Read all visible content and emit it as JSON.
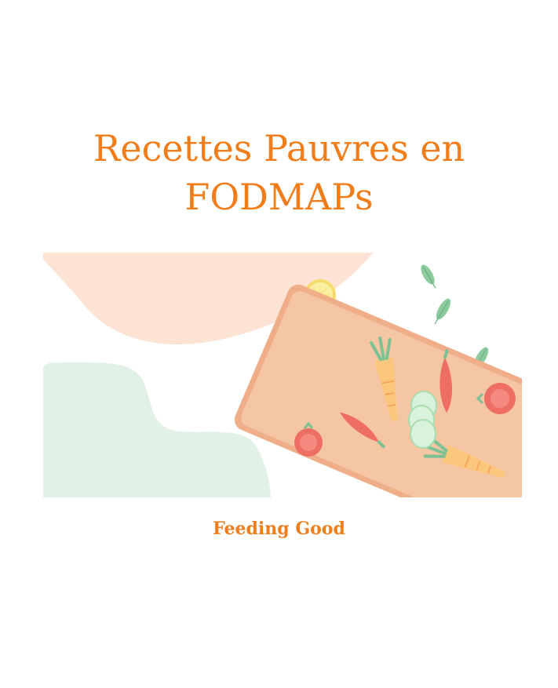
{
  "document": {
    "title_line1": "Recettes Pauvres en",
    "title_line2": "FODMAPs",
    "author": "Feeding Good"
  },
  "illustration": {
    "icons": [
      "lemon-slice-icon",
      "leaf-icon",
      "cutting-board-icon",
      "carrot-icon",
      "chili-pepper-icon",
      "cucumber-slices-icon",
      "tomato-icon"
    ]
  },
  "colors": {
    "accent": "#F07D1A",
    "peach_blob": "#FCE3D4",
    "mint_blob": "#E2F1E6",
    "board": "#F5C6A4",
    "board_edge": "#EFAE88",
    "carrot": "#FBC77C",
    "pepper": "#EE6E64",
    "cucumber": "#D9F2DC",
    "leaf": "#8CCB9E",
    "lemon": "#FBEFA2"
  }
}
